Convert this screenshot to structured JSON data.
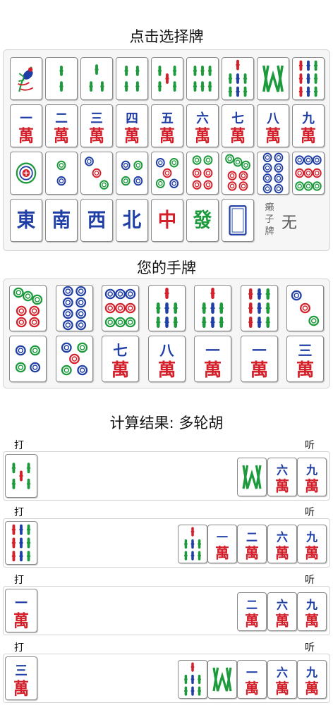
{
  "select_title": "点击选择牌",
  "hand_title": "您的手牌",
  "result_title": "计算结果: 多轮胡",
  "discard_label": "打",
  "listen_label": "听",
  "laizi": {
    "label": "癞子牌",
    "value": "无"
  },
  "colors": {
    "red": "#d4202a",
    "green": "#1c9a3c",
    "blue": "#1f3ea6",
    "bg": "#f6f6f6"
  },
  "selector_rows": [
    [
      "b1",
      "b2",
      "b3",
      "b4",
      "b5",
      "b6",
      "b7",
      "b8",
      "b9"
    ],
    [
      "m1",
      "m2",
      "m3",
      "m4",
      "m5",
      "m6",
      "m7",
      "m8",
      "m9"
    ],
    [
      "p1",
      "p2",
      "p3",
      "p4",
      "p5",
      "p6",
      "p7",
      "p8",
      "p9"
    ],
    [
      "east",
      "south",
      "west",
      "north",
      "red",
      "green",
      "white"
    ]
  ],
  "hand_rows": [
    [
      "p7",
      "p8",
      "p9",
      "b7",
      "b7",
      "b9",
      "p3"
    ],
    [
      "p4",
      "p5",
      "m7",
      "m8",
      "m1",
      "m1",
      "m3"
    ]
  ],
  "results": [
    {
      "discard": "b5",
      "listen": [
        "b8",
        "m6",
        "m9"
      ]
    },
    {
      "discard": "b9",
      "listen": [
        "b7",
        "m1",
        "m2",
        "m6",
        "m9"
      ]
    },
    {
      "discard": "m1",
      "listen": [
        "m2",
        "m6",
        "m9"
      ]
    },
    {
      "discard": "m3",
      "listen": [
        "b7",
        "b8",
        "m1",
        "m6",
        "m9"
      ]
    }
  ]
}
